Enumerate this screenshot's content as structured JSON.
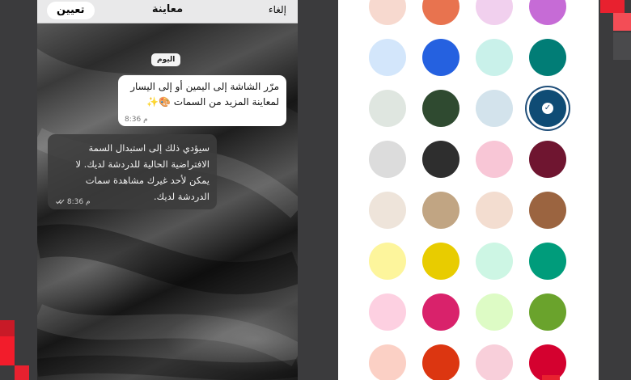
{
  "preview": {
    "header": {
      "set_label": "تعيين",
      "title": "معاينة",
      "cancel_label": "إلغاء"
    },
    "date_chip": "اليوم",
    "outgoing_message": {
      "line1": "مرّر الشاشة إلى اليمين أو إلى اليسار",
      "line2": "لمعاينة المزيد من السمات 🎨✨",
      "time": "8:36 م"
    },
    "incoming_message": {
      "line1": "سيؤدي ذلك إلى استبدال السمة",
      "line2": "الافتراضية الحالية للدردشة لديك. لا",
      "line3": "يمكن لأحد غيرك مشاهدة سمات",
      "line4": "الدردشة لديك.",
      "time": "8:36 م"
    }
  },
  "palette": {
    "accent": "#1f4e79",
    "selected_color": "#0f4c75",
    "rows": [
      [
        "#f7d9cf",
        "#e8734f",
        "#f1d0ee",
        "#c66bd6"
      ],
      [
        "#d3e6fb",
        "#2561e0",
        "#c9f1ea",
        "#017d76"
      ],
      [
        "#dfe6e0",
        "#2f4a30",
        "#d3e3ec",
        "#0f4c75"
      ],
      [
        "#dcdcdc",
        "#2e2e2e",
        "#f8c6d6",
        "#6f1530"
      ],
      [
        "#eee4da",
        "#c1a583",
        "#f3ddd0",
        "#9b6440"
      ],
      [
        "#fdf59c",
        "#e8cc00",
        "#cdf6e4",
        "#009c7b"
      ],
      [
        "#fdd0e1",
        "#d9226b",
        "#ddfbc5",
        "#6aa32c"
      ],
      [
        "#fbd0c5",
        "#dc3611",
        "#f8cfda",
        "#d4012f"
      ]
    ]
  }
}
